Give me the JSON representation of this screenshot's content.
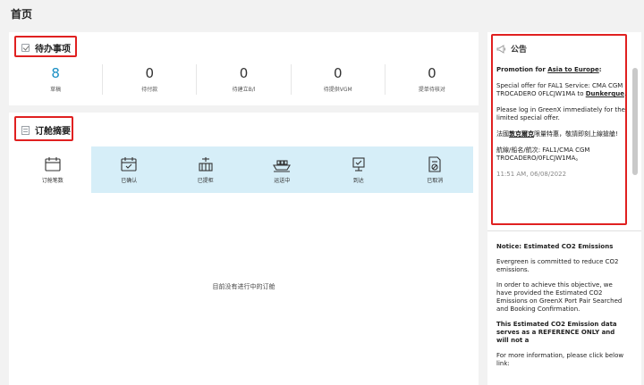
{
  "page": {
    "title": "首页"
  },
  "todo": {
    "title": "待办事项",
    "stats": [
      {
        "value": "8",
        "label": "草稿"
      },
      {
        "value": "0",
        "label": "待付款"
      },
      {
        "value": "0",
        "label": "待建立B/l"
      },
      {
        "value": "0",
        "label": "待提供VGM"
      },
      {
        "value": "0",
        "label": "提单待核对"
      }
    ]
  },
  "orders": {
    "title": "订舱摘要",
    "tabs": [
      {
        "label": "订舱笔数",
        "icon": "calendar-icon"
      },
      {
        "label": "已确认",
        "icon": "calendar-check-icon"
      },
      {
        "label": "已提柜",
        "icon": "crane-container-icon"
      },
      {
        "label": "运送中",
        "icon": "ship-icon"
      },
      {
        "label": "到达",
        "icon": "flag-icon"
      },
      {
        "label": "已取消",
        "icon": "document-cancel-icon"
      }
    ],
    "empty": "目前没有进行中的订舱"
  },
  "notice": {
    "title": "公告",
    "headline_prefix": "Promotion for ",
    "headline_link": "Asia to Europe",
    "headline_suffix": ":",
    "offer_text": "Special offer for FAL1 Service: CMA CGM TROCADERO 0FLCJW1MA to ",
    "offer_link": "Dunkerque",
    "offer_end": ".",
    "login_text": "Please log in GreenX immediately for the limited special offer.",
    "cn_prefix": "法國",
    "cn_link": "敦克爾克",
    "cn_suffix": "限量特惠，敬請即刻上線搶艙!",
    "cn_route": "航線/船名/航次: FAL1/CMA CGM TROCADERO/0FLCJW1MA。",
    "timestamp": "11:51 AM, 06/08/2022",
    "notice2_title": "Notice:  Estimated CO2 Emissions",
    "notice2_p1": "Evergreen is committed to reduce CO2 emissions.",
    "notice2_p2": "In order to achieve this objective, we have provided the Estimated CO2 Emissions on GreenX Port Pair Searched and Booking Confirmation.",
    "notice2_p3": "This Estimated CO2 Emission data serves as a REFERENCE ONLY and will not a",
    "notice2_p4": "For more information, please click below link:"
  },
  "colors": {
    "accent": "#1a8fc4",
    "highlight": "#e02020",
    "tab_bg": "#d6eef8"
  }
}
